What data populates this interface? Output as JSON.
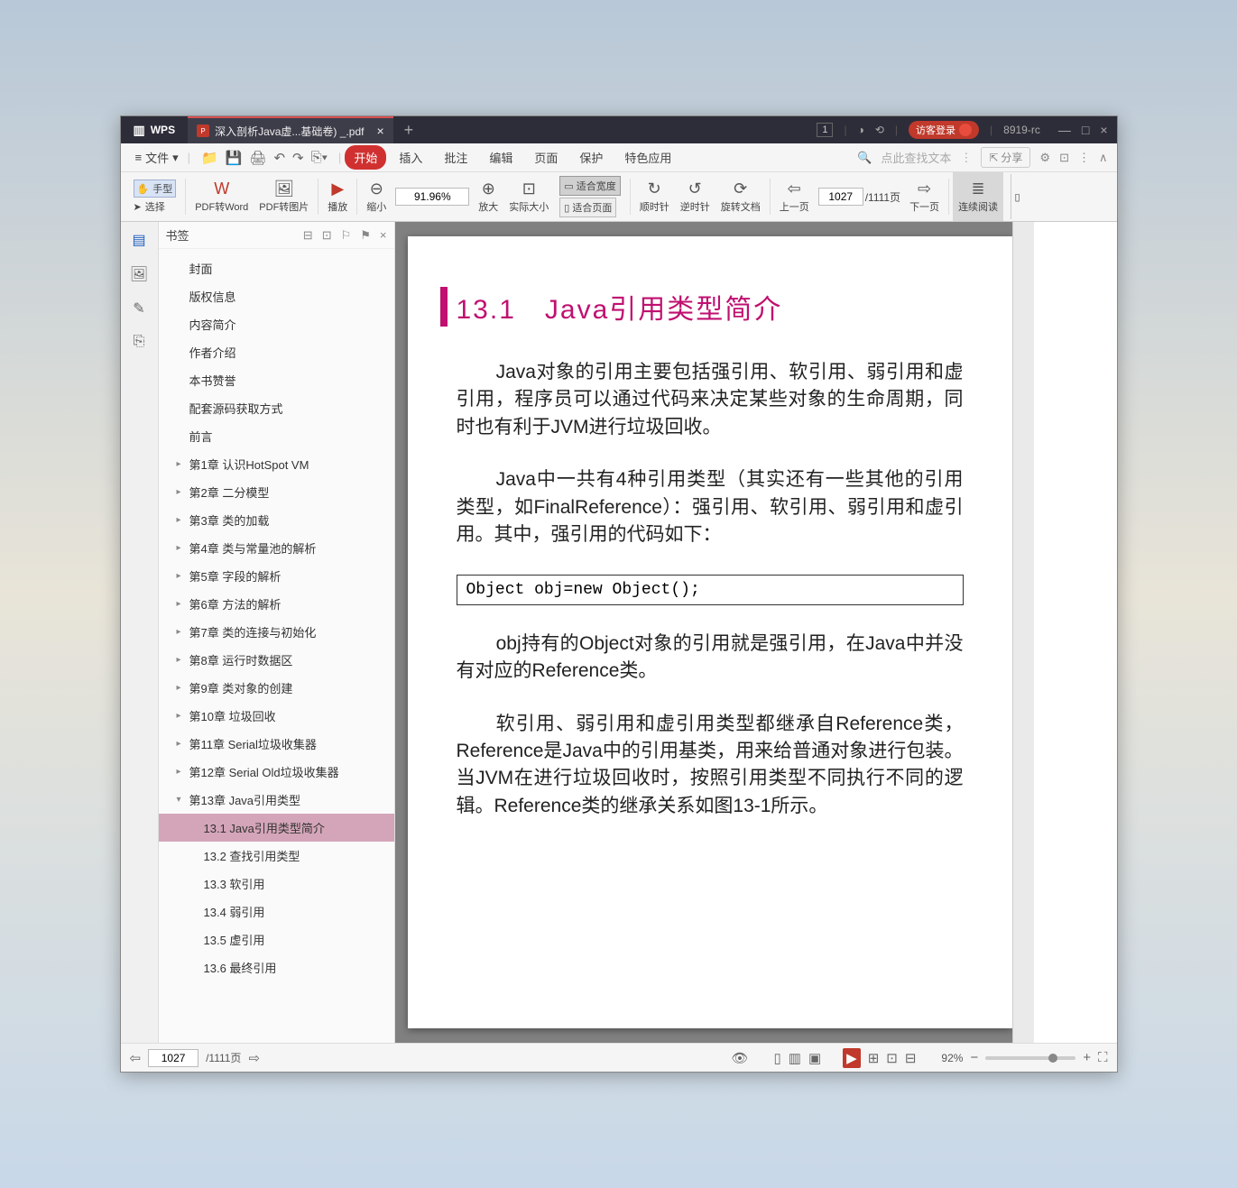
{
  "titlebar": {
    "logo": "WPS",
    "tab_name": "深入剖析Java虚...基础卷) _.pdf",
    "badge": "1",
    "login": "访客登录",
    "version": "8919-rc"
  },
  "menubar": {
    "file": "文件",
    "tabs": [
      "开始",
      "插入",
      "批注",
      "编辑",
      "页面",
      "保护",
      "特色应用"
    ],
    "search_placeholder": "点此查找文本",
    "share": "分享"
  },
  "toolbar": {
    "hand": "手型",
    "select": "选择",
    "pdf2word": "PDF转Word",
    "pdf2img": "PDF转图片",
    "play": "播放",
    "zoom_out": "缩小",
    "zoom_val": "91.96%",
    "zoom_in": "放大",
    "actual_size": "实际大小",
    "fit_width": "适合宽度",
    "fit_page": "适合页面",
    "cw": "顺时针",
    "ccw": "逆时针",
    "rotate_doc": "旋转文档",
    "prev_page": "上一页",
    "page_val": "1027",
    "page_total": "/1111页",
    "next_page": "下一页",
    "cont_read": "连续阅读"
  },
  "bookmark": {
    "title": "书签",
    "items": [
      {
        "label": "封面",
        "level": 1,
        "arrow": false
      },
      {
        "label": "版权信息",
        "level": 1,
        "arrow": false
      },
      {
        "label": "内容简介",
        "level": 1,
        "arrow": false
      },
      {
        "label": "作者介绍",
        "level": 1,
        "arrow": false
      },
      {
        "label": "本书赞誉",
        "level": 1,
        "arrow": false
      },
      {
        "label": "配套源码获取方式",
        "level": 1,
        "arrow": false
      },
      {
        "label": "前言",
        "level": 1,
        "arrow": false
      },
      {
        "label": "第1章 认识HotSpot VM",
        "level": 1,
        "arrow": true
      },
      {
        "label": "第2章 二分模型",
        "level": 1,
        "arrow": true
      },
      {
        "label": "第3章 类的加载",
        "level": 1,
        "arrow": true
      },
      {
        "label": "第4章 类与常量池的解析",
        "level": 1,
        "arrow": true
      },
      {
        "label": "第5章 字段的解析",
        "level": 1,
        "arrow": true
      },
      {
        "label": "第6章 方法的解析",
        "level": 1,
        "arrow": true
      },
      {
        "label": "第7章 类的连接与初始化",
        "level": 1,
        "arrow": true
      },
      {
        "label": "第8章 运行时数据区",
        "level": 1,
        "arrow": true
      },
      {
        "label": "第9章 类对象的创建",
        "level": 1,
        "arrow": true
      },
      {
        "label": "第10章 垃圾回收",
        "level": 1,
        "arrow": true
      },
      {
        "label": "第11章 Serial垃圾收集器",
        "level": 1,
        "arrow": true
      },
      {
        "label": "第12章 Serial Old垃圾收集器",
        "level": 1,
        "arrow": true
      },
      {
        "label": "第13章 Java引用类型",
        "level": 1,
        "arrow": true,
        "expanded": true
      },
      {
        "label": "13.1 Java引用类型简介",
        "level": 2,
        "arrow": false,
        "selected": true
      },
      {
        "label": "13.2 查找引用类型",
        "level": 2,
        "arrow": false
      },
      {
        "label": "13.3 软引用",
        "level": 2,
        "arrow": false
      },
      {
        "label": "13.4 弱引用",
        "level": 2,
        "arrow": false
      },
      {
        "label": "13.5 虚引用",
        "level": 2,
        "arrow": false
      },
      {
        "label": "13.6 最终引用",
        "level": 2,
        "arrow": false
      }
    ]
  },
  "document": {
    "heading": "13.1　Java引用类型简介",
    "p1": "Java对象的引用主要包括强引用、软引用、弱引用和虚引用，程序员可以通过代码来决定某些对象的生命周期，同时也有利于JVM进行垃圾回收。",
    "p2": "Java中一共有4种引用类型（其实还有一些其他的引用类型，如FinalReference）：强引用、软引用、弱引用和虚引用。其中，强引用的代码如下：",
    "code": "Object obj=new Object();",
    "p3": "obj持有的Object对象的引用就是强引用，在Java中并没有对应的Reference类。",
    "p4": "软引用、弱引用和虚引用类型都继承自Reference类，Reference是Java中的引用基类，用来给普通对象进行包装。当JVM在进行垃圾回收时，按照引用类型不同执行不同的逻辑。Reference类的继承关系如图13-1所示。"
  },
  "statusbar": {
    "page_val": "1027",
    "page_total": "/1111页",
    "zoom": "92%"
  }
}
